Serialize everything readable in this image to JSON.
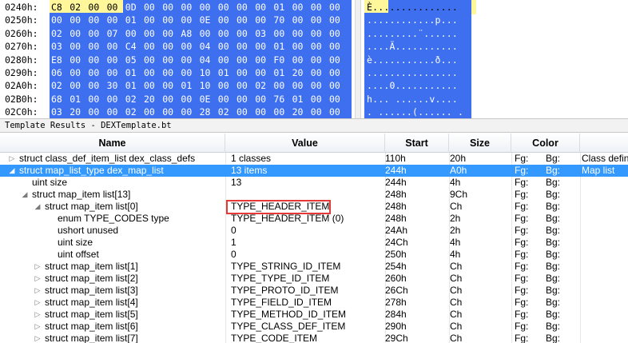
{
  "hex": {
    "rows": [
      {
        "addr": "0240h:",
        "bytes": [
          "C8",
          "02",
          "00",
          "00",
          "0D",
          "00",
          "00",
          "00",
          "00",
          "00",
          "00",
          "00",
          "01",
          "00",
          "00",
          "00"
        ],
        "ascii": "È..............."
      },
      {
        "addr": "0250h:",
        "bytes": [
          "00",
          "00",
          "00",
          "00",
          "01",
          "00",
          "00",
          "00",
          "0E",
          "00",
          "00",
          "00",
          "70",
          "00",
          "00",
          "00"
        ],
        "ascii": "............p..."
      },
      {
        "addr": "0260h:",
        "bytes": [
          "02",
          "00",
          "00",
          "07",
          "00",
          "00",
          "00",
          "A8",
          "00",
          "00",
          "00",
          "03",
          "00",
          "00",
          "00",
          "00"
        ],
        "ascii": ".........¨......"
      },
      {
        "addr": "0270h:",
        "bytes": [
          "03",
          "00",
          "00",
          "00",
          "C4",
          "00",
          "00",
          "00",
          "04",
          "00",
          "00",
          "00",
          "01",
          "00",
          "00",
          "00"
        ],
        "ascii": "....Ä..........."
      },
      {
        "addr": "0280h:",
        "bytes": [
          "E8",
          "00",
          "00",
          "00",
          "05",
          "00",
          "00",
          "00",
          "04",
          "00",
          "00",
          "00",
          "F0",
          "00",
          "00",
          "00"
        ],
        "ascii": "è...........ð..."
      },
      {
        "addr": "0290h:",
        "bytes": [
          "06",
          "00",
          "00",
          "00",
          "01",
          "00",
          "00",
          "00",
          "10",
          "01",
          "00",
          "00",
          "01",
          "20",
          "00",
          "00"
        ],
        "ascii": "................"
      },
      {
        "addr": "02A0h:",
        "bytes": [
          "02",
          "00",
          "00",
          "30",
          "01",
          "00",
          "00",
          "01",
          "10",
          "00",
          "00",
          "02",
          "00",
          "00",
          "00",
          "00"
        ],
        "ascii": "....0..........."
      },
      {
        "addr": "02B0h:",
        "bytes": [
          "68",
          "01",
          "00",
          "00",
          "02",
          "20",
          "00",
          "00",
          "0E",
          "00",
          "00",
          "00",
          "76",
          "01",
          "00",
          "00"
        ],
        "ascii": "h... ......v...."
      },
      {
        "addr": "02C0h:",
        "bytes": [
          "03",
          "20",
          "00",
          "00",
          "02",
          "00",
          "00",
          "00",
          "28",
          "02",
          "00",
          "00",
          "00",
          "20",
          "00",
          "00"
        ],
        "ascii": ". ......(...... ."
      }
    ]
  },
  "template": {
    "title": "Template Results - DEXTemplate.bt",
    "columns": {
      "name": "Name",
      "value": "Value",
      "start": "Start",
      "size": "Size",
      "color": "Color"
    },
    "rows": [
      {
        "name": "struct class_def_item_list dex_class_defs",
        "value": "1 classes",
        "start": "110h",
        "size": "20h",
        "fg": "Fg:",
        "bg": "Bg:",
        "comment": "Class defin",
        "indent": 0,
        "expander": "closed",
        "selected": false
      },
      {
        "name": "struct map_list_type dex_map_list",
        "value": "13 items",
        "start": "244h",
        "size": "A0h",
        "fg": "Fg:",
        "bg": "Bg:",
        "comment": "Map list",
        "indent": 0,
        "expander": "open",
        "selected": true
      },
      {
        "name": "uint size",
        "value": "13",
        "start": "244h",
        "size": "4h",
        "fg": "Fg:",
        "bg": "Bg:",
        "comment": "",
        "indent": 1,
        "expander": "none",
        "selected": false
      },
      {
        "name": "struct map_item list[13]",
        "value": "",
        "start": "248h",
        "size": "9Ch",
        "fg": "Fg:",
        "bg": "Bg:",
        "comment": "",
        "indent": 1,
        "expander": "open",
        "selected": false
      },
      {
        "name": "struct map_item list[0]",
        "value": "TYPE_HEADER_ITEM",
        "start": "248h",
        "size": "Ch",
        "fg": "Fg:",
        "bg": "Bg:",
        "comment": "",
        "indent": 2,
        "expander": "open",
        "selected": false
      },
      {
        "name": "enum TYPE_CODES type",
        "value": "TYPE_HEADER_ITEM (0)",
        "start": "248h",
        "size": "2h",
        "fg": "Fg:",
        "bg": "Bg:",
        "comment": "",
        "indent": 3,
        "expander": "none",
        "selected": false
      },
      {
        "name": "ushort unused",
        "value": "0",
        "start": "24Ah",
        "size": "2h",
        "fg": "Fg:",
        "bg": "Bg:",
        "comment": "",
        "indent": 3,
        "expander": "none",
        "selected": false
      },
      {
        "name": "uint size",
        "value": "1",
        "start": "24Ch",
        "size": "4h",
        "fg": "Fg:",
        "bg": "Bg:",
        "comment": "",
        "indent": 3,
        "expander": "none",
        "selected": false
      },
      {
        "name": "uint offset",
        "value": "0",
        "start": "250h",
        "size": "4h",
        "fg": "Fg:",
        "bg": "Bg:",
        "comment": "",
        "indent": 3,
        "expander": "none",
        "selected": false
      },
      {
        "name": "struct map_item list[1]",
        "value": "TYPE_STRING_ID_ITEM",
        "start": "254h",
        "size": "Ch",
        "fg": "Fg:",
        "bg": "Bg:",
        "comment": "",
        "indent": 2,
        "expander": "closed",
        "selected": false
      },
      {
        "name": "struct map_item list[2]",
        "value": "TYPE_TYPE_ID_ITEM",
        "start": "260h",
        "size": "Ch",
        "fg": "Fg:",
        "bg": "Bg:",
        "comment": "",
        "indent": 2,
        "expander": "closed",
        "selected": false
      },
      {
        "name": "struct map_item list[3]",
        "value": "TYPE_PROTO_ID_ITEM",
        "start": "26Ch",
        "size": "Ch",
        "fg": "Fg:",
        "bg": "Bg:",
        "comment": "",
        "indent": 2,
        "expander": "closed",
        "selected": false
      },
      {
        "name": "struct map_item list[4]",
        "value": "TYPE_FIELD_ID_ITEM",
        "start": "278h",
        "size": "Ch",
        "fg": "Fg:",
        "bg": "Bg:",
        "comment": "",
        "indent": 2,
        "expander": "closed",
        "selected": false
      },
      {
        "name": "struct map_item list[5]",
        "value": "TYPE_METHOD_ID_ITEM",
        "start": "284h",
        "size": "Ch",
        "fg": "Fg:",
        "bg": "Bg:",
        "comment": "",
        "indent": 2,
        "expander": "closed",
        "selected": false
      },
      {
        "name": "struct map_item list[6]",
        "value": "TYPE_CLASS_DEF_ITEM",
        "start": "290h",
        "size": "Ch",
        "fg": "Fg:",
        "bg": "Bg:",
        "comment": "",
        "indent": 2,
        "expander": "closed",
        "selected": false
      },
      {
        "name": "struct map_item list[7]",
        "value": "TYPE_CODE_ITEM",
        "start": "29Ch",
        "size": "Ch",
        "fg": "Fg:",
        "bg": "Bg:",
        "comment": "",
        "indent": 2,
        "expander": "closed",
        "selected": false
      }
    ]
  },
  "colors": {
    "selection": "#3399ff",
    "hex_selection": "#3d6fef",
    "highlight": "#fff79a",
    "annotation_box": "#e53935"
  }
}
